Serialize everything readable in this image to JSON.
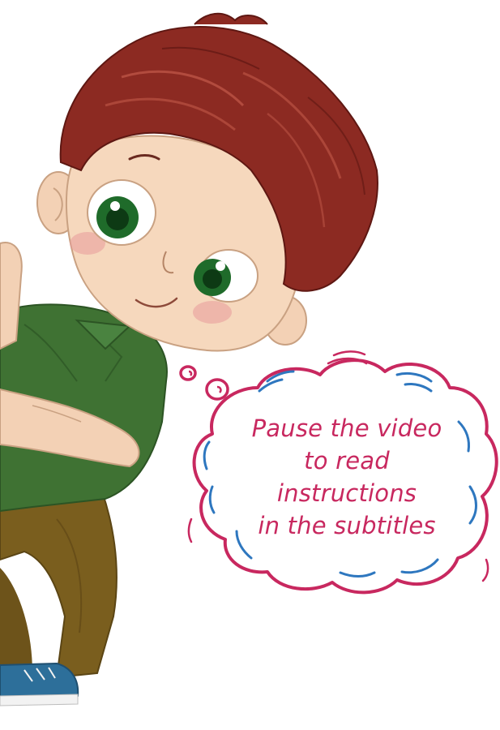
{
  "illustration": {
    "subject": "boy-character-icon"
  },
  "thought_bubble": {
    "lines": [
      "Pause the video",
      "to read",
      "instructions",
      "in the subtitles"
    ]
  },
  "colors": {
    "bubble_outline": "#c8285f",
    "bubble_accent": "#2e77bf",
    "text": "#c8285f",
    "hair": "#8c2a22",
    "shirt": "#3f7233",
    "pants": "#7a5e1e",
    "skin": "#f3d1b5",
    "eyes": "#1f6b2a"
  }
}
